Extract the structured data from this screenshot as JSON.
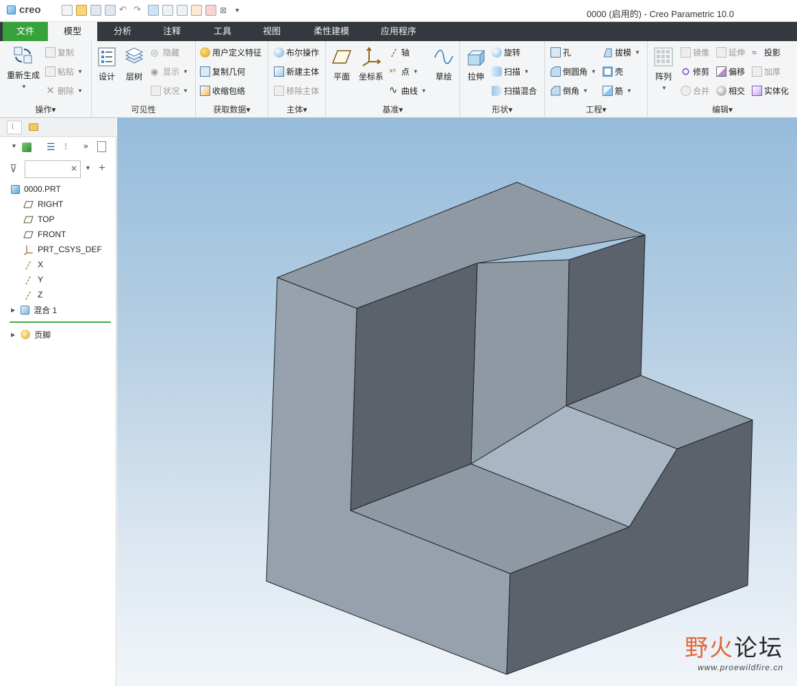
{
  "app": {
    "logo": "creo",
    "window_title": "0000 (启用的) - Creo Parametric 10.0"
  },
  "quick_access": [
    "new-icon",
    "open-icon",
    "save-icon",
    "save-copy-icon",
    "undo-icon",
    "redo-icon",
    "regenerate-icon",
    "switch-window-icon",
    "windows-icon",
    "close-icon",
    "customize-icon"
  ],
  "tabs": [
    {
      "label": "文件",
      "state": "file"
    },
    {
      "label": "模型",
      "state": "active"
    },
    {
      "label": "分析"
    },
    {
      "label": "注释"
    },
    {
      "label": "工具"
    },
    {
      "label": "视图"
    },
    {
      "label": "柔性建模"
    },
    {
      "label": "应用程序"
    }
  ],
  "ribbon": {
    "operations": {
      "label": "操作▾",
      "regen": "重新生成",
      "copy": "复制",
      "paste": "粘贴",
      "delete": "删除"
    },
    "visibility": {
      "label": "可见性",
      "design": "设计",
      "layer_tree": "层树",
      "hide": "隐藏",
      "show": "显示",
      "status": "状况"
    },
    "get_data": {
      "label": "获取数据▾",
      "udf": "用户定义特征",
      "copy_geom": "复制几何",
      "shrinkwrap": "收缩包络"
    },
    "body": {
      "label": "主体▾",
      "boolean": "布尔操作",
      "new_body": "新建主体",
      "remove_body": "移除主体"
    },
    "datum": {
      "label": "基准▾",
      "plane": "平面",
      "csys": "坐标系",
      "axis": "轴",
      "point": "点",
      "curve": "曲线",
      "sketch": "草绘"
    },
    "shapes": {
      "label": "形状▾",
      "extrude": "拉伸",
      "revolve": "旋转",
      "sweep": "扫描",
      "swept_blend": "扫描混合"
    },
    "engineering": {
      "label": "工程▾",
      "hole": "孔",
      "round": "倒圆角",
      "chamfer": "倒角",
      "draft": "拔模",
      "shell": "壳",
      "rib": "筋"
    },
    "editing": {
      "label": "编辑▾",
      "pattern": "阵列",
      "mirror": "镜像",
      "extend": "延伸",
      "project": "投影",
      "trim": "修剪",
      "offset": "偏移",
      "thicken": "加厚",
      "merge": "合并",
      "intersect": "相交",
      "solidify": "实体化"
    }
  },
  "model_tree": {
    "items": [
      {
        "label": "0000.PRT",
        "icon": "part-icon"
      },
      {
        "label": "RIGHT",
        "icon": "datum-plane-icon"
      },
      {
        "label": "TOP",
        "icon": "datum-plane-icon"
      },
      {
        "label": "FRONT",
        "icon": "datum-plane-icon"
      },
      {
        "label": "PRT_CSYS_DEF",
        "icon": "csys-icon"
      },
      {
        "label": "X",
        "icon": "axis-icon"
      },
      {
        "label": "Y",
        "icon": "axis-icon"
      },
      {
        "label": "Z",
        "icon": "axis-icon"
      },
      {
        "label": "混合 1",
        "icon": "blend-icon"
      },
      {
        "label": "页脚",
        "icon": "footer-icon"
      }
    ]
  },
  "colors": {
    "file_tab": "#37a23b",
    "tab_bar": "#33393e",
    "face_light": "#a9b6c4",
    "face_mid": "#8e99a4",
    "face_dark": "#5b626b"
  },
  "watermark": {
    "title_a": "野火",
    "title_b": "论坛",
    "url": "www.proewildfire.cn"
  }
}
